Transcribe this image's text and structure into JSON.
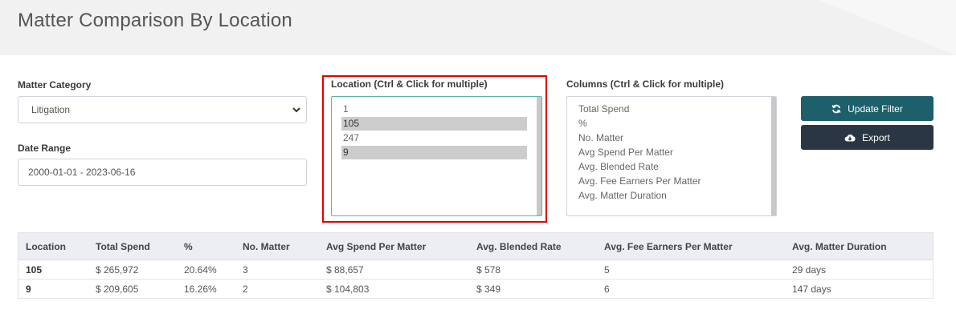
{
  "header": {
    "title": "Matter Comparison By Location"
  },
  "filters": {
    "matter_category": {
      "label": "Matter Category",
      "value": "Litigation"
    },
    "date_range": {
      "label": "Date Range",
      "value": "2000-01-01 - 2023-06-16"
    },
    "location": {
      "label": "Location (Ctrl & Click for multiple)",
      "options": [
        {
          "text": "1",
          "selected": false
        },
        {
          "text": "105",
          "selected": true
        },
        {
          "text": "247",
          "selected": false
        },
        {
          "text": "9",
          "selected": true
        }
      ]
    },
    "columns": {
      "label": "Columns (Ctrl & Click for multiple)",
      "options": [
        {
          "text": "Total Spend",
          "selected": false
        },
        {
          "text": "%",
          "selected": false
        },
        {
          "text": "No. Matter",
          "selected": false
        },
        {
          "text": "Avg Spend Per Matter",
          "selected": false
        },
        {
          "text": "Avg. Blended Rate",
          "selected": false
        },
        {
          "text": "Avg. Fee Earners Per Matter",
          "selected": false
        },
        {
          "text": "Avg. Matter Duration",
          "selected": false
        }
      ]
    }
  },
  "buttons": {
    "update_filter": {
      "label": "Update Filter",
      "icon": "refresh-icon",
      "color": "#1d5f6b"
    },
    "export": {
      "label": "Export",
      "icon": "cloud-download-icon",
      "color": "#2b3644"
    }
  },
  "table": {
    "headers": [
      "Location",
      "Total Spend",
      "%",
      "No. Matter",
      "Avg Spend Per Matter",
      "Avg. Blended Rate",
      "Avg. Fee Earners Per Matter",
      "Avg. Matter Duration"
    ],
    "rows": [
      [
        "105",
        "$ 265,972",
        "20.64%",
        "3",
        "$ 88,657",
        "$ 578",
        "5",
        "29 days"
      ],
      [
        "9",
        "$ 209,605",
        "16.26%",
        "2",
        "$ 104,803",
        "$ 349",
        "6",
        "147 days"
      ]
    ]
  }
}
